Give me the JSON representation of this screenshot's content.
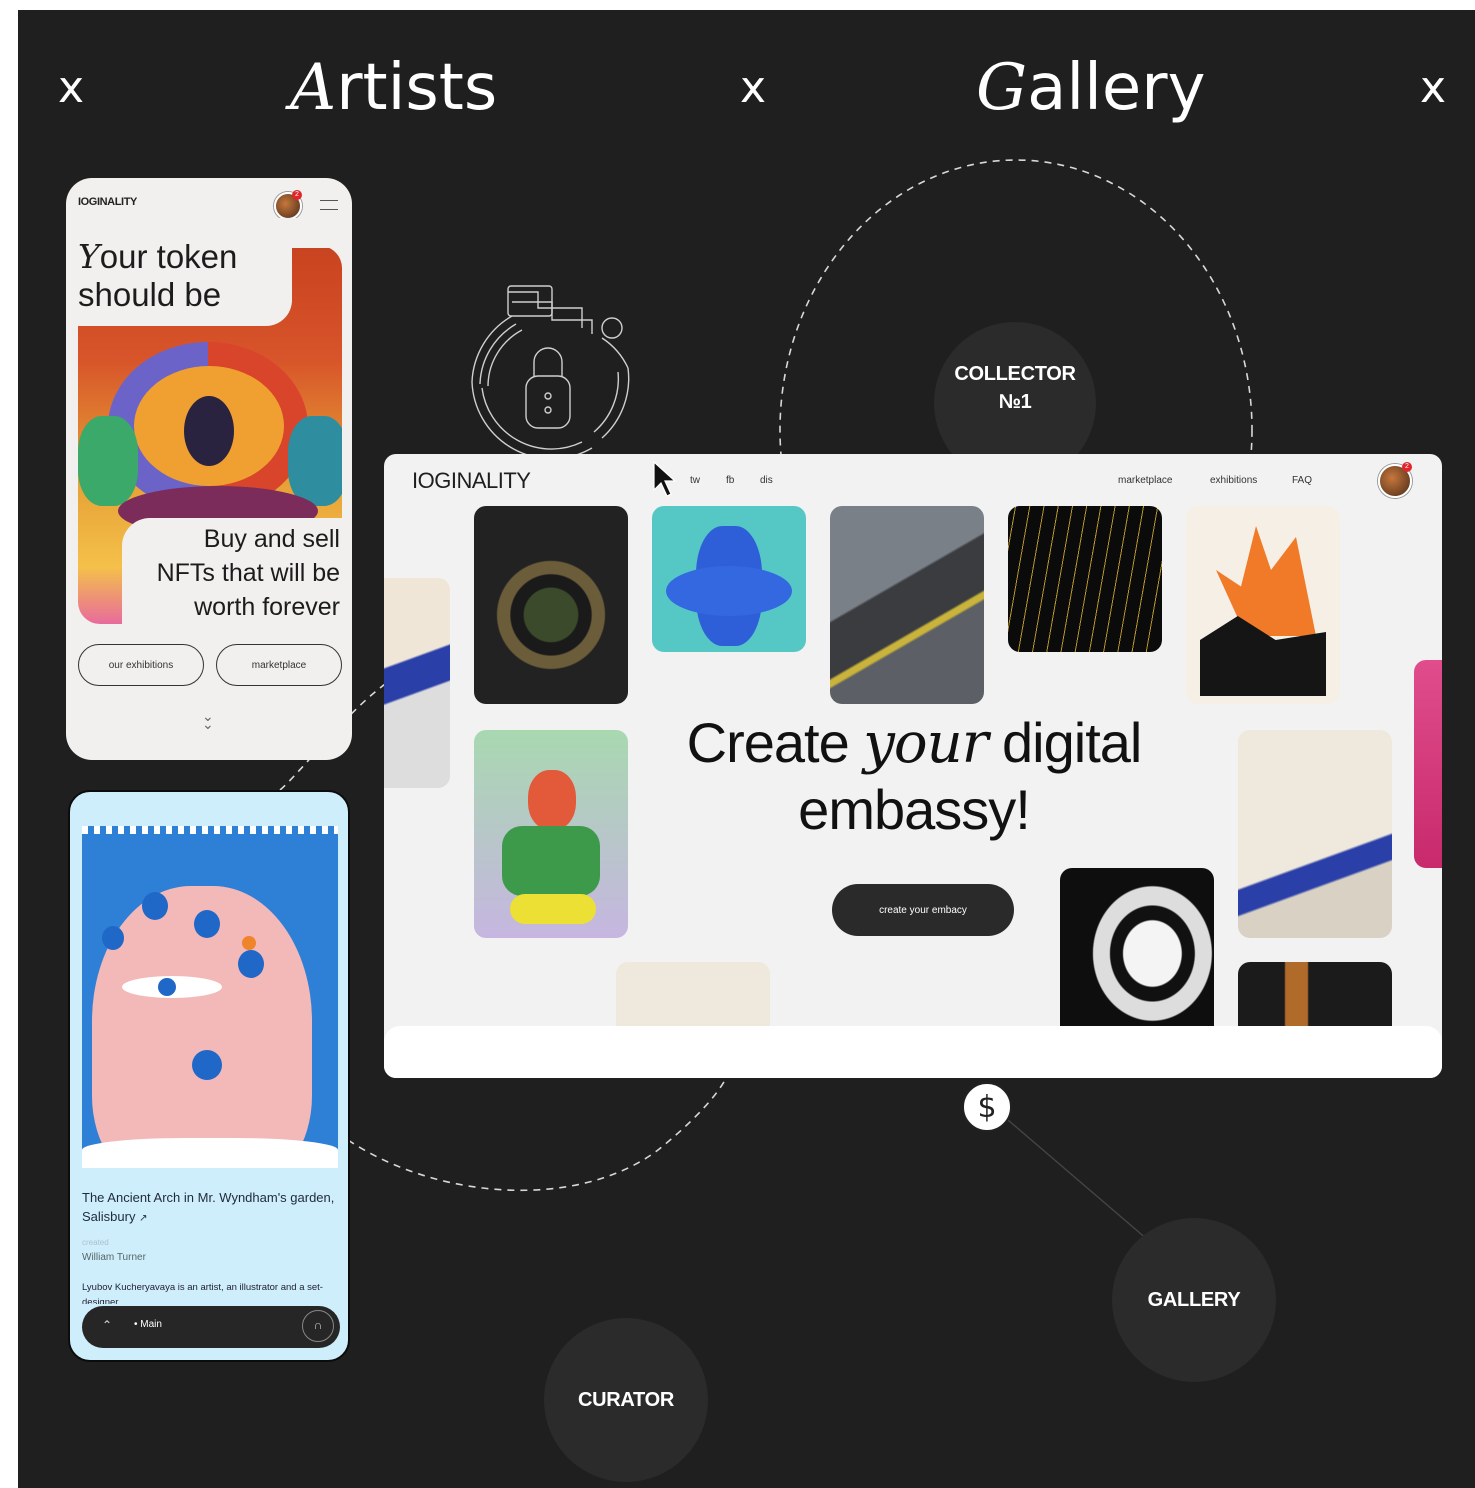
{
  "header": {
    "separators": [
      "x",
      "x",
      "x"
    ],
    "word1": {
      "cap": "A",
      "rest": "rtists"
    },
    "word2": {
      "cap": "G",
      "rest": "allery"
    }
  },
  "nodes": {
    "collector_line1": "COLLECTOR",
    "collector_line2": "№1",
    "gallery": "GALLERY",
    "curator": "CURATOR"
  },
  "mobile_home": {
    "logo": "IOGINALITY",
    "badge": "2",
    "headline_cap": "Y",
    "headline_line1_rest": "our token",
    "headline_line2": "should be",
    "tagline_line1": "Buy and sell",
    "tagline_line2": "NFTs that will be",
    "tagline_line3": "worth forever",
    "btn_exhibitions": "our exhibitions",
    "btn_marketplace": "marketplace"
  },
  "mobile_artwork": {
    "title": "The Ancient Arch in Mr. Wyndham's garden, Salisbury",
    "arrow": "↗",
    "created_label": "created",
    "artist": "William Turner",
    "bio": "Lyubov Kucheryavaya is an artist, an illustrator and a set-designer",
    "bottom_nav": "• Main"
  },
  "desktop": {
    "logo": "IOGINALITY",
    "social": [
      "tw",
      "fb",
      "dis"
    ],
    "nav": [
      "marketplace",
      "exhibitions",
      "FAQ"
    ],
    "badge": "2",
    "headline_w1": "Create",
    "headline_italic": "your",
    "headline_w3": "digital",
    "headline_line2": "embassy!",
    "cta": "create your embacy"
  },
  "icons": {
    "dollar": "$",
    "lock": "lock-icon",
    "cursor": "cursor-icon"
  },
  "colors": {
    "background": "#1f1f1f",
    "node": "#2b2b2b",
    "phone_light": "#f1f0ee",
    "phone_blue": "#cfeefc",
    "browser_bg": "#f2f2f2",
    "cta_dark": "#2a2a2a"
  }
}
